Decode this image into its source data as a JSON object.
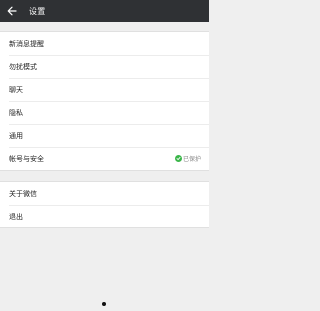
{
  "header": {
    "title": "设置",
    "back_icon": "arrow-left-icon"
  },
  "settings": {
    "group1": [
      {
        "label": "新消息提醒"
      },
      {
        "label": "勿扰模式"
      },
      {
        "label": "聊天"
      },
      {
        "label": "隐私"
      },
      {
        "label": "通用"
      },
      {
        "label": "帐号与安全",
        "status": "已保护",
        "status_icon": "shield-check-icon",
        "status_color": "#3bb64a"
      }
    ],
    "group2": [
      {
        "label": "关于微信"
      },
      {
        "label": "退出"
      }
    ]
  },
  "colors": {
    "titlebar": "#2f3134",
    "background": "#efefef"
  }
}
